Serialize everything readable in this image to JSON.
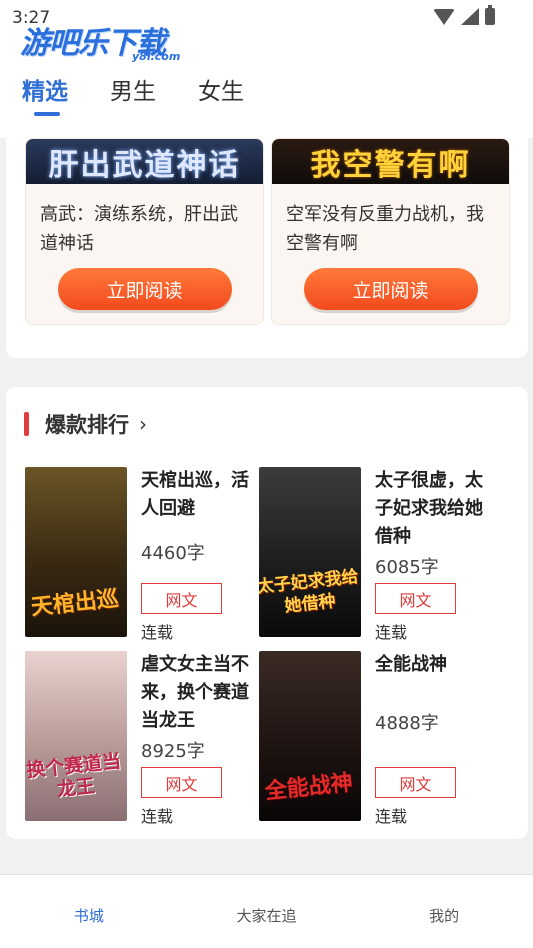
{
  "status": {
    "time": "3:27"
  },
  "logo": {
    "main": "游吧乐下载",
    "sub": "y8l.com"
  },
  "tabs": [
    {
      "label": "精选",
      "active": true
    },
    {
      "label": "男生",
      "active": false
    },
    {
      "label": "女生",
      "active": false
    }
  ],
  "featured": [
    {
      "banner": "肝出武道神话",
      "title": "高武：演练系统，肝出武道神话",
      "button": "立即阅读"
    },
    {
      "banner": "我空警有啊",
      "title": "空军没有反重力战机，我空警有啊",
      "button": "立即阅读"
    }
  ],
  "ranking": {
    "title": "爆款排行",
    "books": [
      {
        "title": "天棺出巡，活人回避",
        "words": "4460字",
        "tag": "网文",
        "status": "连载",
        "cover_text": "天棺出巡"
      },
      {
        "title": "太子很虚，太子妃求我给她借种",
        "words": "6085字",
        "tag": "网文",
        "status": "连载",
        "cover_text": "太子妃求我给她借种"
      },
      {
        "title": "虐文女主当不来，换个赛道当龙王",
        "words": "8925字",
        "tag": "网文",
        "status": "连载",
        "cover_text": "换个赛道当龙王"
      },
      {
        "title": "全能战神",
        "words": "4888字",
        "tag": "网文",
        "status": "连载",
        "cover_text": "全能战神"
      }
    ]
  },
  "bottom_nav": [
    {
      "label": "书城",
      "active": true
    },
    {
      "label": "大家在追",
      "active": false
    },
    {
      "label": "我的",
      "active": false
    }
  ],
  "colors": {
    "accent": "#2f6fd6",
    "button": "#f24a1d",
    "tag": "#e03a3a"
  }
}
